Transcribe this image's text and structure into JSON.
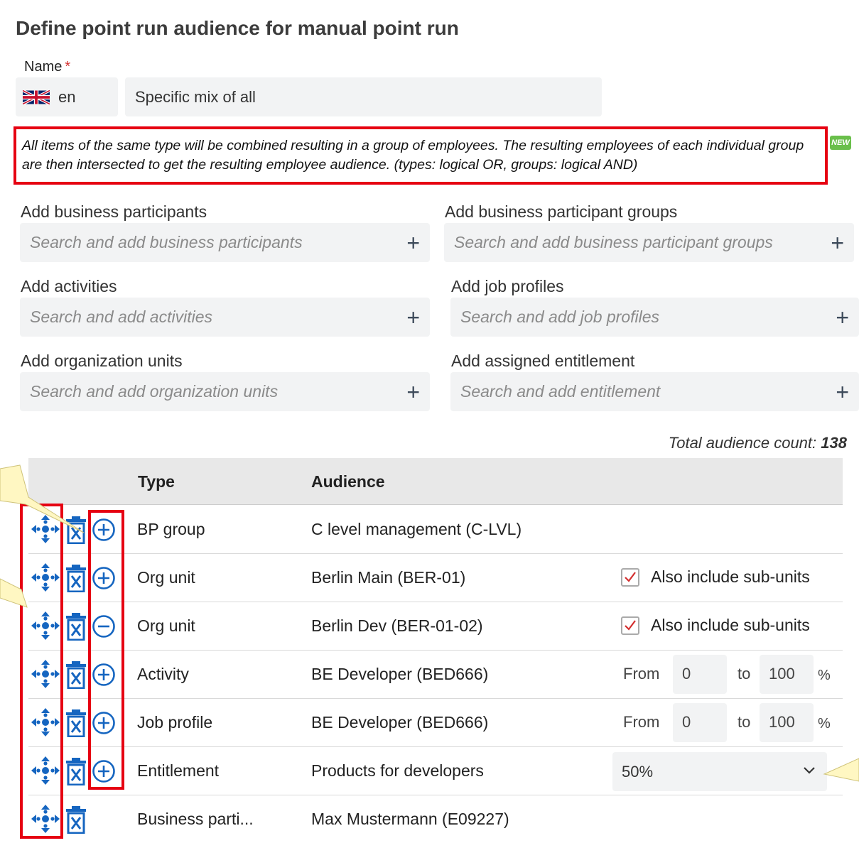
{
  "page": {
    "title": "Define point run audience for manual point run"
  },
  "name_field": {
    "label": "Name",
    "required_mark": "*",
    "language": "en",
    "value": "Specific mix of all"
  },
  "note": {
    "text": "All items of the same type will be combined resulting in a group of employees. The resulting employees of each individual group are then intersected to get the resulting employee audience. (types: logical OR, groups: logical AND)",
    "badge": "NEW"
  },
  "search_fields": {
    "bp": {
      "label": "Add business participants",
      "placeholder": "Search and add business participants"
    },
    "bpg": {
      "label": "Add business participant groups",
      "placeholder": "Search and add business participant groups"
    },
    "act": {
      "label": "Add activities",
      "placeholder": "Search and add activities"
    },
    "job": {
      "label": "Add job profiles",
      "placeholder": "Search and add job profiles"
    },
    "org": {
      "label": "Add organization units",
      "placeholder": "Search and add organization units"
    },
    "ent": {
      "label": "Add assigned entitlement",
      "placeholder": "Search and add entitlement"
    }
  },
  "total": {
    "label": "Total audience count:",
    "value": "138"
  },
  "table": {
    "headers": {
      "type": "Type",
      "audience": "Audience"
    },
    "rows": [
      {
        "type": "BP group",
        "audience": "C level management (C-LVL)",
        "toggle": "plus"
      },
      {
        "type": "Org unit",
        "audience": "Berlin Main (BER-01)",
        "toggle": "plus",
        "checkbox_label": "Also include sub-units",
        "checked": true
      },
      {
        "type": "Org unit",
        "audience": "Berlin Dev (BER-01-02)",
        "toggle": "minus",
        "checkbox_label": "Also include sub-units",
        "checked": true
      },
      {
        "type": "Activity",
        "audience": "BE Developer (BED666)",
        "toggle": "plus",
        "from_label": "From",
        "from": "0",
        "to_label": "to",
        "to": "100",
        "unit": "%"
      },
      {
        "type": "Job profile",
        "audience": "BE Developer (BED666)",
        "toggle": "plus",
        "from_label": "From",
        "from": "0",
        "to_label": "to",
        "to": "100",
        "unit": "%"
      },
      {
        "type": "Entitlement",
        "audience": "Products for developers",
        "toggle": "plus",
        "select_value": "50%"
      },
      {
        "type": "Business parti...",
        "audience": "Max Mustermann (E09227)"
      }
    ]
  },
  "colors": {
    "accent": "#1565c0",
    "highlight": "#e60012",
    "callout": "#fff7c2"
  }
}
